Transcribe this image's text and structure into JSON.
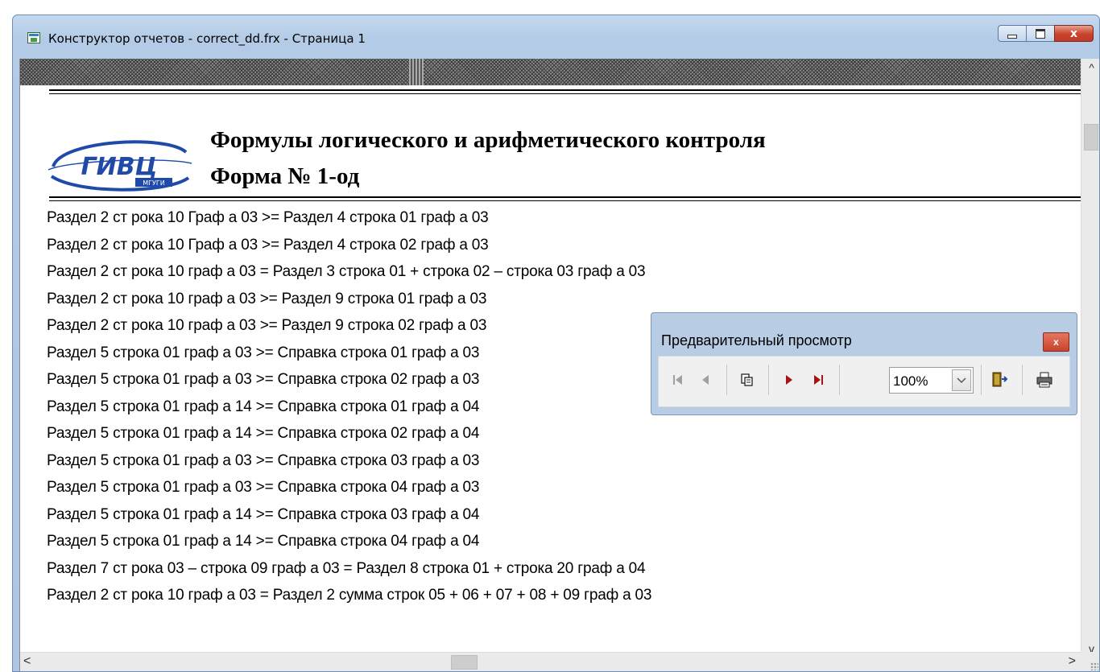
{
  "window": {
    "title": "Конструктор отчетов - correct_dd.frx - Страница 1",
    "close_glyph": "x"
  },
  "report": {
    "title": "Формулы логического и арифметического контроля",
    "subtitle": "Форма № 1-од",
    "logo_text": "ГИВЦ",
    "logo_subtext": "МГУГИ",
    "rows": [
      "Раздел 2 ст рока 10 Граф а 03 >= Раздел 4 строка 01 граф а 03",
      "Раздел 2 ст рока 10 Граф а 03 >= Раздел 4 строка 02 граф а 03",
      "Раздел 2 ст рока 10 граф а 03 = Раздел 3 строка 01 + строка 02 – строка 03 граф а 03",
      "Раздел 2 ст рока 10 граф а 03 >= Раздел 9 строка 01 граф а 03",
      "Раздел 2 ст рока 10 граф а 03 >= Раздел 9 строка 02 граф а 03",
      "Раздел 5 строка 01 граф а 03 >= Справка строка 01 граф а 03",
      "Раздел 5 строка 01 граф а 03 >= Справка строка 02 граф а 03",
      "Раздел 5 строка 01 граф а 14 >= Справка строка 01 граф а 04",
      "Раздел 5 строка 01 граф а 14 >= Справка строка 02 граф а 04",
      "Раздел 5 строка 01 граф а 03 >= Справка строка 03 граф а 03",
      "Раздел 5 строка 01 граф а 03 >= Справка строка 04 граф а 03",
      "Раздел 5 строка 01 граф а 14 >= Справка строка 03 граф а 04",
      "Раздел 5 строка 01 граф а 14 >= Справка строка 04 граф а 04",
      "Раздел 7 ст рока 03 – строка 09 граф а 03 = Раздел 8 строка 01 + строка 20 граф а 04",
      "Раздел 2 ст рока 10 граф а 03 = Раздел 2 сумма строк 05 + 06 + 07 + 08 + 09 граф а 03"
    ]
  },
  "preview_toolbar": {
    "title": "Предварительный просмотр",
    "close_glyph": "x",
    "zoom_value": "100%"
  },
  "scroll": {
    "up": "^",
    "down": "v",
    "left": "<",
    "right": ">"
  }
}
